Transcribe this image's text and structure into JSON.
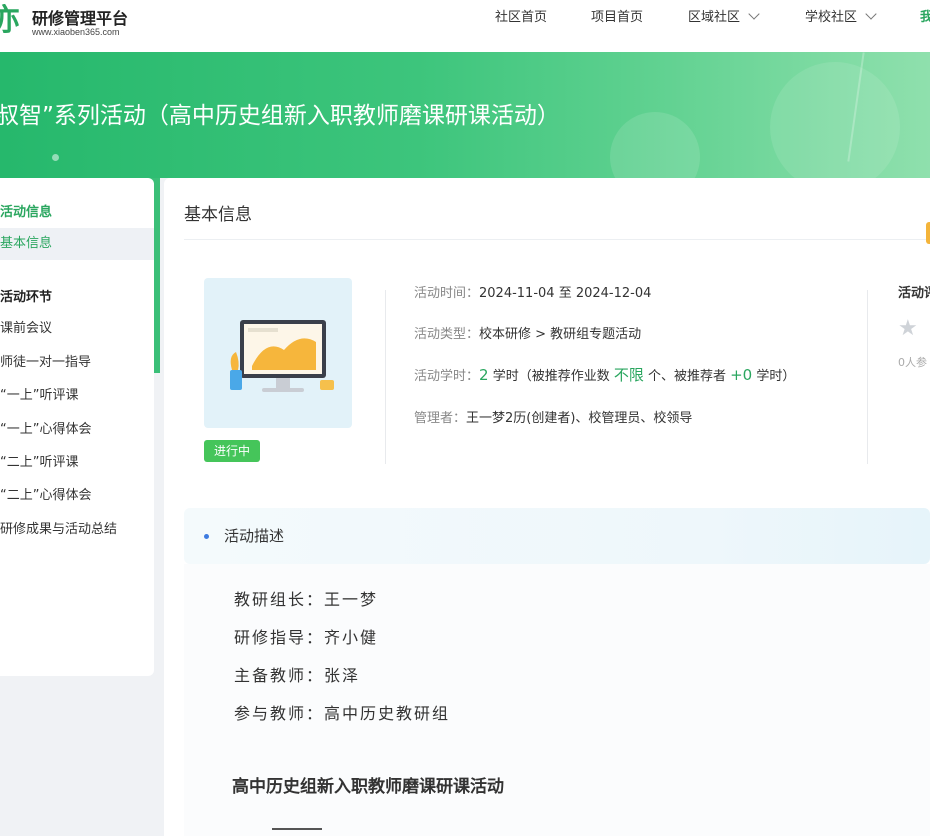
{
  "header": {
    "logo_glyph": "亦",
    "logo_title": "研修管理平台",
    "logo_url": "www.xiaoben365.com",
    "nav": [
      {
        "label": "社区首页",
        "dropdown": false
      },
      {
        "label": "项目首页",
        "dropdown": false
      },
      {
        "label": "区域社区",
        "dropdown": true
      },
      {
        "label": "学校社区",
        "dropdown": true
      }
    ],
    "nav_more": "我"
  },
  "banner": {
    "title": "叔智”系列活动（高中历史组新入职教师磨课研课活动）"
  },
  "sidebar": {
    "section1_title": "活动信息",
    "section1_items": [
      "基本信息"
    ],
    "section2_title": "活动环节",
    "section2_items": [
      "课前会议",
      "师徒一对一指导",
      "“一上”听评课",
      "“一上”心得体会",
      "“二上”听评课",
      "“二上”心得体会",
      "研修成果与活动总结"
    ]
  },
  "main": {
    "card_title": "基本信息",
    "status_badge": "进行中",
    "info": {
      "time_label": "活动时间：",
      "time_value": "2024-11-04 至 2024-12-04",
      "type_label": "活动类型：",
      "type_value": "校本研修 > 教研组专题活动",
      "hours_label": "活动学时：",
      "hours_num": "2",
      "hours_text1": " 学时（被推荐作业数 ",
      "hours_limit": "不限",
      "hours_text2": " 个、被推荐者 ",
      "hours_bonus": "+0",
      "hours_text3": " 学时）",
      "manager_label": "管理者：",
      "manager_value": "王一梦2历(创建者)、校管理员、校领导"
    },
    "side_panel_title": "活动评",
    "side_panel_count": "0人参"
  },
  "description": {
    "title": "活动描述",
    "lines": [
      "教研组长：王一梦",
      "研修指导：齐小健",
      "主备教师：张泽",
      "参与教师：高中历史教研组"
    ],
    "heading": "高中历史组新入职教师磨课研课活动"
  },
  "colors": {
    "accent": "#2aa65f",
    "banner_start": "#26b86c",
    "status_green": "#45c55a",
    "bullet_blue": "#3d7be0",
    "orange_tab": "#f4b43a"
  }
}
